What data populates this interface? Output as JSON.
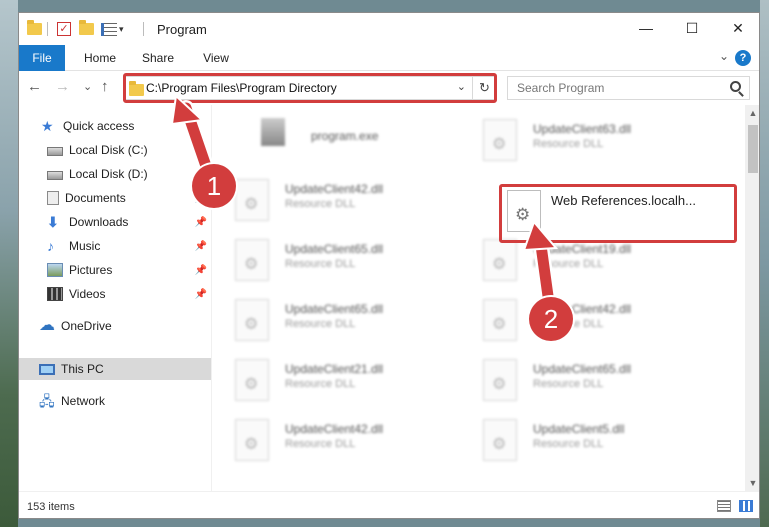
{
  "window": {
    "title": "Program",
    "controls": {
      "minimize": "—",
      "maximize": "☐",
      "close": "✕"
    }
  },
  "quick_access_toolbar": {
    "dropdown": "▾"
  },
  "ribbon": {
    "tabs": [
      "File",
      "Home",
      "Share",
      "View"
    ],
    "collapse": "⌄",
    "help": "?"
  },
  "nav": {
    "back": "←",
    "forward": "→",
    "recent": "⌄",
    "up": "↑",
    "address": "C:\\Program Files\\Program Directory",
    "address_dropdown": "⌄",
    "refresh": "↻",
    "search_placeholder": "Search Program"
  },
  "sidebar": {
    "items": [
      {
        "label": "Quick access",
        "icon": "star-icon",
        "pinned": false
      },
      {
        "label": "Local Disk (C:)",
        "icon": "disk-icon",
        "pinned": false
      },
      {
        "label": "Local Disk (D:)",
        "icon": "disk-icon",
        "pinned": false
      },
      {
        "label": "Documents",
        "icon": "documents-icon",
        "pinned": true
      },
      {
        "label": "Downloads",
        "icon": "download-icon",
        "pinned": true
      },
      {
        "label": "Music",
        "icon": "music-icon",
        "pinned": true
      },
      {
        "label": "Pictures",
        "icon": "pictures-icon",
        "pinned": true
      },
      {
        "label": "Videos",
        "icon": "videos-icon",
        "pinned": true
      },
      {
        "label": "OneDrive",
        "icon": "cloud-icon",
        "pinned": false
      },
      {
        "label": "This PC",
        "icon": "pc-icon",
        "pinned": false,
        "selected": true
      },
      {
        "label": "Network",
        "icon": "network-icon",
        "pinned": false
      }
    ],
    "pin_glyph": "📌"
  },
  "files": {
    "left_column": [
      {
        "name": "program.exe",
        "type": ""
      },
      {
        "name": "UpdateClient42.dll",
        "type": "Resource DLL"
      },
      {
        "name": "UpdateClient65.dll",
        "type": "Resource DLL"
      },
      {
        "name": "UpdateClient65.dll",
        "type": "Resource DLL"
      },
      {
        "name": "UpdateClient21.dll",
        "type": "Resource DLL"
      },
      {
        "name": "UpdateClient42.dll",
        "type": "Resource DLL"
      }
    ],
    "right_column": [
      {
        "name": "UpdateClient63.dll",
        "type": "Resource DLL"
      },
      {
        "name": "UpdateClient19.dll",
        "type": "Resource DLL"
      },
      {
        "name": "UpdateClient42.dll",
        "type": "Resource DLL"
      },
      {
        "name": "UpdateClient65.dll",
        "type": "Resource DLL"
      },
      {
        "name": "UpdateClient5.dll",
        "type": "Resource DLL"
      }
    ],
    "focused_file": {
      "name": "Web References.localh..."
    }
  },
  "status": {
    "item_count": "153 items"
  },
  "annotations": {
    "step1": "1",
    "step2": "2"
  },
  "colors": {
    "accent": "#1979ca",
    "highlight": "#d23d3d"
  }
}
